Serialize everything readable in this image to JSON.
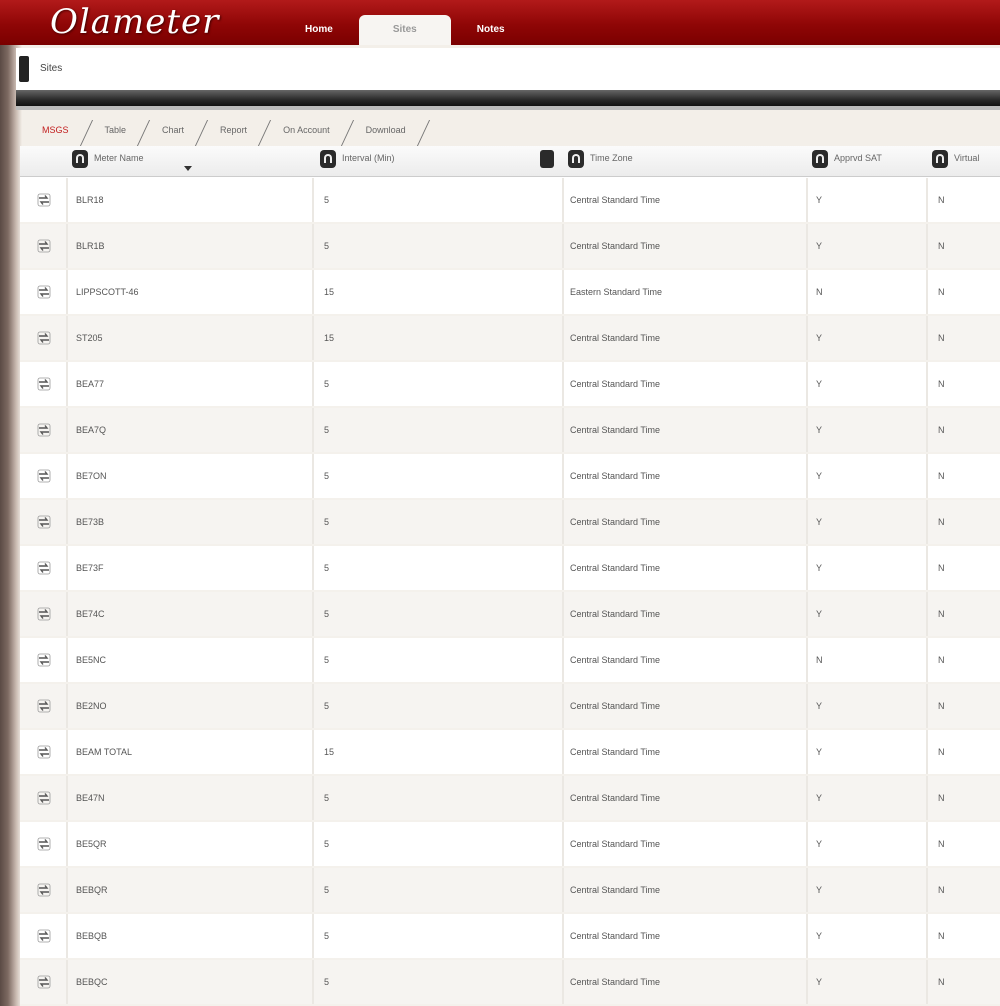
{
  "app": {
    "logo": "Olameter"
  },
  "nav": {
    "tabs": [
      {
        "label": "Home"
      },
      {
        "label": "Sites"
      },
      {
        "label": "Notes"
      }
    ]
  },
  "subbar": {
    "breadcrumb": "Sites"
  },
  "tabs": [
    {
      "label": "MSGS"
    },
    {
      "label": "Table"
    },
    {
      "label": "Chart"
    },
    {
      "label": "Report"
    },
    {
      "label": "On Account"
    },
    {
      "label": "Download"
    }
  ],
  "grid": {
    "columns": [
      {
        "label": "Meter Name"
      },
      {
        "label": "Interval (Min)"
      },
      {
        "label": "Time Zone"
      },
      {
        "label": "Apprvd SAT"
      },
      {
        "label": "Virtual"
      }
    ],
    "rows": [
      {
        "name": "BLR18",
        "interval": "5",
        "tz": "Central Standard Time",
        "a": "Y",
        "v": "N"
      },
      {
        "name": "BLR1B",
        "interval": "5",
        "tz": "Central Standard Time",
        "a": "Y",
        "v": "N"
      },
      {
        "name": "LIPPSCOTT-46",
        "interval": "15",
        "tz": "Eastern Standard Time",
        "a": "N",
        "v": "N"
      },
      {
        "name": "ST205",
        "interval": "15",
        "tz": "Central Standard Time",
        "a": "Y",
        "v": "N"
      },
      {
        "name": "BEA77",
        "interval": "5",
        "tz": "Central Standard Time",
        "a": "Y",
        "v": "N"
      },
      {
        "name": "BEA7Q",
        "interval": "5",
        "tz": "Central Standard Time",
        "a": "Y",
        "v": "N"
      },
      {
        "name": "BE7ON",
        "interval": "5",
        "tz": "Central Standard Time",
        "a": "Y",
        "v": "N"
      },
      {
        "name": "BE73B",
        "interval": "5",
        "tz": "Central Standard Time",
        "a": "Y",
        "v": "N"
      },
      {
        "name": "BE73F",
        "interval": "5",
        "tz": "Central Standard Time",
        "a": "Y",
        "v": "N"
      },
      {
        "name": "BE74C",
        "interval": "5",
        "tz": "Central Standard Time",
        "a": "Y",
        "v": "N"
      },
      {
        "name": "BE5NC",
        "interval": "5",
        "tz": "Central Standard Time",
        "a": "N",
        "v": "N"
      },
      {
        "name": "BE2NO",
        "interval": "5",
        "tz": "Central Standard Time",
        "a": "Y",
        "v": "N"
      },
      {
        "name": "BEAM TOTAL",
        "interval": "15",
        "tz": "Central Standard Time",
        "a": "Y",
        "v": "N"
      },
      {
        "name": "BE47N",
        "interval": "5",
        "tz": "Central Standard Time",
        "a": "Y",
        "v": "N"
      },
      {
        "name": "BE5QR",
        "interval": "5",
        "tz": "Central Standard Time",
        "a": "Y",
        "v": "N"
      },
      {
        "name": "BEBQR",
        "interval": "5",
        "tz": "Central Standard Time",
        "a": "Y",
        "v": "N"
      },
      {
        "name": "BEBQB",
        "interval": "5",
        "tz": "Central Standard Time",
        "a": "Y",
        "v": "N"
      },
      {
        "name": "BEBQC",
        "interval": "5",
        "tz": "Central Standard Time",
        "a": "Y",
        "v": "N"
      }
    ]
  },
  "colors": {
    "header_red": "#8f0606",
    "active_tab": "#c21e1e"
  }
}
